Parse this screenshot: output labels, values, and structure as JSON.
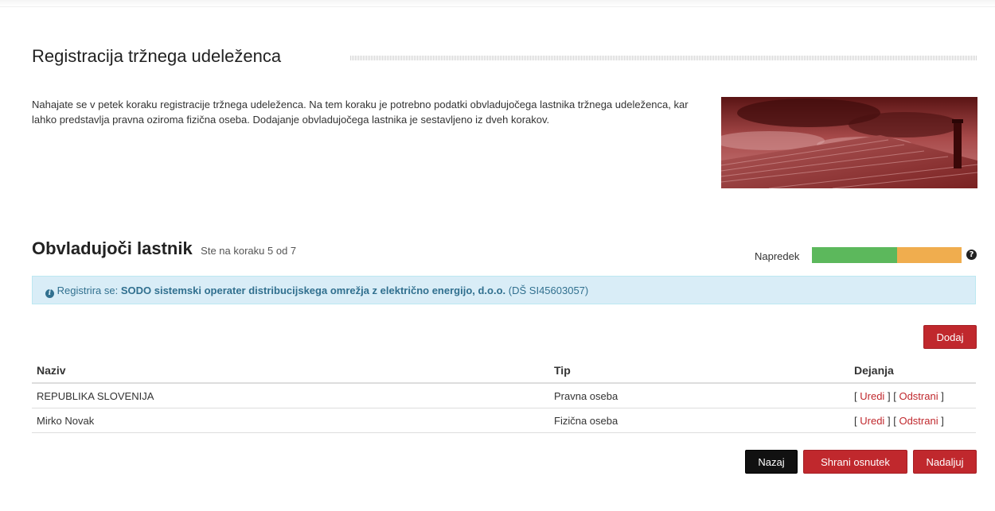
{
  "header": {
    "title": "Registracija tržnega udeleženca"
  },
  "intro": {
    "text": "Nahajate se v petek koraku registracije tržnega udeleženca. Na tem koraku je potrebno podatki obvladujočega lastnika tržnega udeleženca, kar lahko predstavlja pravna oziroma fizična oseba. Dodajanje obvladujočega lastnika je sestavljeno iz dveh korakov."
  },
  "section": {
    "title": "Obvladujoči lastnik",
    "step_text": "Ste na koraku 5 od 7"
  },
  "progress": {
    "label": "Napredek",
    "value_fraction": 0.57,
    "colors": {
      "done": "#5cb85c",
      "remaining": "#f0ad4e"
    },
    "help_icon": "question-circle-icon",
    "help_glyph": "?"
  },
  "alert": {
    "prefix": "Registrira se:",
    "organization": "SODO sistemski operater distribucijskega omrežja z električno energijo, d.o.o.",
    "id_text": "(DŠ SI45603057)",
    "icon": "info-circle-icon",
    "icon_glyph": "i"
  },
  "buttons": {
    "add": "Dodaj",
    "back": "Nazaj",
    "save_draft": "Shrani osnutek",
    "next": "Nadaljuj"
  },
  "table": {
    "headers": {
      "name": "Naziv",
      "type": "Tip",
      "actions": "Dejanja"
    },
    "rows": [
      {
        "name": "REPUBLIKA SLOVENIJA",
        "type": "Pravna oseba",
        "edit": "Uredi",
        "remove": "Odstrani"
      },
      {
        "name": "Mirko Novak",
        "type": "Fizična oseba",
        "edit": "Uredi",
        "remove": "Odstrani"
      }
    ],
    "bracket_open": "[",
    "bracket_close": "]"
  },
  "colors": {
    "accent_red": "#c0282d",
    "info_bg": "#d9edf7",
    "info_text": "#31708f"
  }
}
